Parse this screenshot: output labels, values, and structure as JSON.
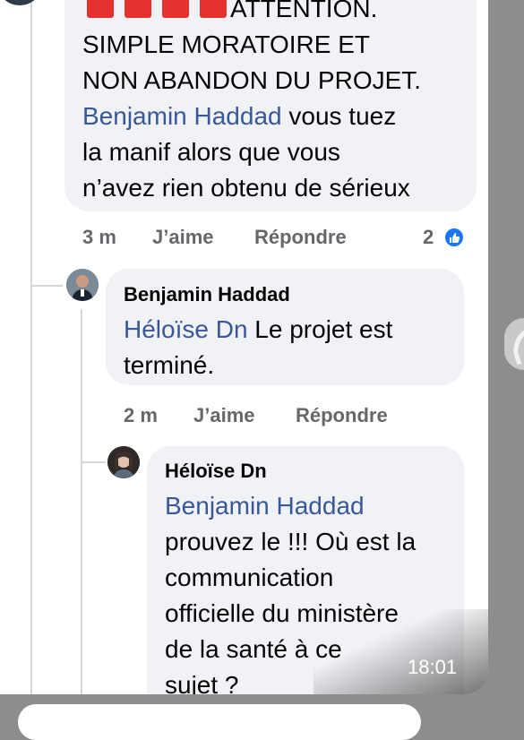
{
  "comment1": {
    "emoji_count": 4,
    "line1": "ATTENTION.",
    "line2": "SIMPLE MORATOIRE ET",
    "line3": "NON ABANDON DU PROJET.",
    "mention": "Benjamin Haddad",
    "line4_rest": " vous tuez",
    "line5": "la manif alors que vous",
    "line6": "n’avez rien obtenu de sérieux",
    "time": "3 m",
    "like": "J’aime",
    "reply": "Répondre",
    "reaction_count": "2"
  },
  "comment2": {
    "author": "Benjamin Haddad",
    "mention": "Héloïse Dn",
    "line1_rest": " Le projet est",
    "line2": "terminé.",
    "time": "2 m",
    "like": "J’aime",
    "reply": "Répondre"
  },
  "comment3": {
    "author": "Héloïse Dn",
    "mention": "Benjamin Haddad",
    "line1": "prouvez le !!! Où est la",
    "line2": "communication",
    "line3": "officielle du ministère",
    "line4": "de la santé à ce",
    "line5": "sujet ?"
  },
  "status": {
    "time": "18:01"
  },
  "colors": {
    "link": "#385898",
    "bubble": "#f0f2f5",
    "meta": "#65676b",
    "reaction": "#1877f2"
  }
}
